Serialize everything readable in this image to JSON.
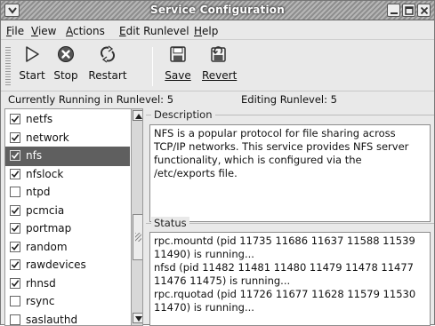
{
  "window": {
    "title": "Service Configuration"
  },
  "menu": [
    {
      "label": "File",
      "ul": "F",
      "rest": "ile"
    },
    {
      "label": "View",
      "ul": "V",
      "rest": "iew"
    },
    {
      "label": "Actions",
      "ul": "A",
      "rest": "ctions"
    },
    {
      "label": "Edit Runlevel",
      "ul": "E",
      "rest": "dit Runlevel"
    },
    {
      "label": "Help",
      "ul": "H",
      "rest": "elp"
    }
  ],
  "toolbar": {
    "start": "Start",
    "stop": "Stop",
    "restart": "Restart",
    "save": "Save",
    "revert": "Revert"
  },
  "status": {
    "running": "Currently Running in Runlevel: 5",
    "editing": "Editing Runlevel: 5"
  },
  "services": [
    {
      "name": "netfs",
      "checked": true,
      "selected": false
    },
    {
      "name": "network",
      "checked": true,
      "selected": false
    },
    {
      "name": "nfs",
      "checked": true,
      "selected": true
    },
    {
      "name": "nfslock",
      "checked": true,
      "selected": false
    },
    {
      "name": "ntpd",
      "checked": false,
      "selected": false
    },
    {
      "name": "pcmcia",
      "checked": true,
      "selected": false
    },
    {
      "name": "portmap",
      "checked": true,
      "selected": false
    },
    {
      "name": "random",
      "checked": true,
      "selected": false
    },
    {
      "name": "rawdevices",
      "checked": true,
      "selected": false
    },
    {
      "name": "rhnsd",
      "checked": true,
      "selected": false
    },
    {
      "name": "rsync",
      "checked": false,
      "selected": false
    },
    {
      "name": "saslauthd",
      "checked": false,
      "selected": false
    }
  ],
  "description": {
    "label": "Description",
    "text": "NFS is a popular protocol for file sharing across TCP/IP networks. This service provides NFS server functionality, which is configured via the /etc/exports file."
  },
  "service_status": {
    "label": "Status",
    "lines": [
      "rpc.mountd (pid 11735 11686 11637 11588 11539 11490) is running...",
      "nfsd (pid 11482 11481 11480 11479 11478 11477 11476 11475) is running...",
      "rpc.rquotad (pid 11726 11677 11628 11579 11530 11470) is running..."
    ]
  },
  "colors": {
    "selected_row": "#5f5f5f",
    "window_bg": "#e9e9e9"
  },
  "icons": {
    "start": "play-icon",
    "stop": "stop-icon",
    "restart": "restart-icon",
    "save": "floppy-icon",
    "revert": "revert-icon"
  }
}
